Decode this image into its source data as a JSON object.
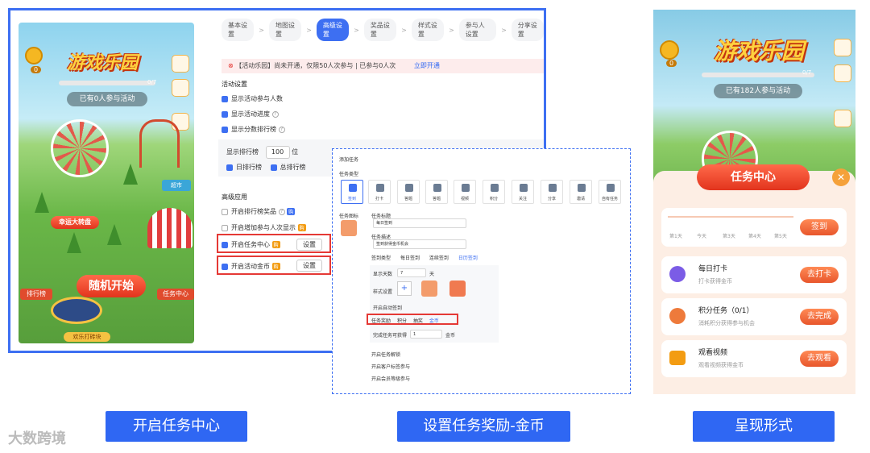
{
  "phone1": {
    "logo": "游戏乐园",
    "coins": "0",
    "progress": "0/7",
    "participants": "已有0人参与活动",
    "side": [
      "奖品",
      "任务",
      "我的奖品"
    ],
    "badges": [
      "幸运大转盘",
      "超市",
      "欢乐打砖块"
    ],
    "start": "随机开始",
    "rank": "排行榜",
    "task_center": "任务中心"
  },
  "settings": {
    "steps": [
      "基本设置",
      "地图设置",
      "高级设置",
      "奖品设置",
      "样式设置",
      "参与人设置",
      "分享设置"
    ],
    "alert": {
      "text": "【活动乐园】尚未开通，仅限50人次参与 | 已参与0人次",
      "link": "立即开通"
    },
    "activity_title": "活动设置",
    "options": [
      "显示活动参与人数",
      "显示活动进度",
      "显示分数排行榜"
    ],
    "rank_label": "显示排行榜",
    "rank_value": "100",
    "rank_unit": "位",
    "rank_day": "日排行榜",
    "rank_total": "总排行榜",
    "advanced_title": "高级应用",
    "adv": [
      "开启排行榜奖品",
      "开启增加参与人次显示",
      "开启任务中心",
      "开启活动金币"
    ],
    "tag": "购",
    "set": "设置"
  },
  "task": {
    "title": "添加任务",
    "type_label": "任务类型",
    "types": [
      "签到",
      "打卡",
      "答题",
      "答题",
      "视频",
      "积分",
      "关注",
      "分享",
      "邀请",
      "自有任务"
    ],
    "icon_label": "任务图标",
    "name_label": "任务标题",
    "name_value": "每日签到",
    "desc_label": "任务描述",
    "desc_value": "签到获得金币机会",
    "sign_label": "签到类型",
    "sign_opts": [
      "每日签到",
      "连续签到",
      "日历签到"
    ],
    "days_label": "显示天数",
    "days_value": "7",
    "days_unit": "天",
    "style_label": "样式设置",
    "auto": "开启自动签到",
    "reward_label": "任务奖励",
    "rewards": [
      "积分",
      "抽奖",
      "金币"
    ],
    "complete_label": "完成任务可获得",
    "complete_value": "1",
    "complete_unit": "金币",
    "extra": [
      "开启任务解锁",
      "开启客户标签参与",
      "开启会员等级参与"
    ]
  },
  "phone3": {
    "logo": "游戏乐园",
    "coins": "0",
    "progress": "0/7",
    "participants": "已有182人参与活动",
    "side": [
      "奖品",
      "任务",
      "我的奖品"
    ],
    "panel_title": "任务中心",
    "days": [
      "第1天",
      "今天",
      "第3天",
      "第4天",
      "第5天"
    ],
    "sign_btn": "签到",
    "tasks": [
      {
        "name": "每日打卡",
        "desc": "打卡获得金币",
        "btn": "去打卡"
      },
      {
        "name": "积分任务（0/1）",
        "desc": "消耗积分获得参与机会",
        "btn": "去完成"
      },
      {
        "name": "观看视频",
        "desc": "观看视频获得金币",
        "btn": "去观看"
      }
    ]
  },
  "captions": [
    "开启任务中心",
    "设置任务奖励-金币",
    "呈现形式"
  ],
  "watermark": "大数跨境",
  "colors": {
    "accent": "#2f67f3",
    "alert": "#e53935",
    "orange": "#ee6a35"
  }
}
